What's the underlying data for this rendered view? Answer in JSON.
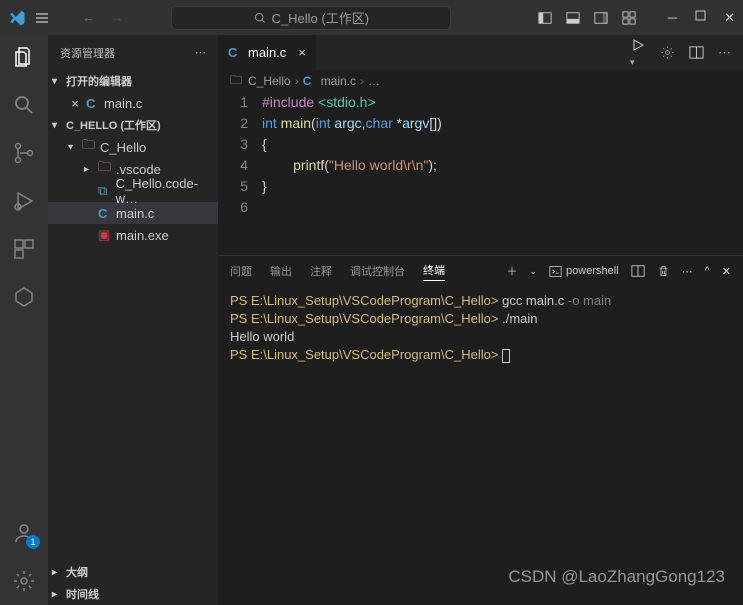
{
  "titlebar": {
    "search_text": "C_Hello (工作区)"
  },
  "sidebar": {
    "title": "资源管理器",
    "open_editors_label": "打开的编辑器",
    "workspace_label": "C_HELLO (工作区)",
    "outline_label": "大纲",
    "timeline_label": "时间线",
    "open_editors": [
      {
        "name": "main.c",
        "icon": "C"
      }
    ],
    "tree": {
      "folder": "C_Hello",
      "children": [
        {
          "name": ".vscode",
          "type": "folder"
        },
        {
          "name": "C_Hello.code-w…",
          "type": "code"
        },
        {
          "name": "main.c",
          "type": "c",
          "active": true
        },
        {
          "name": "main.exe",
          "type": "exe"
        }
      ]
    }
  },
  "accounts_badge": "1",
  "editor": {
    "tab_label": "main.c",
    "breadcrumb": [
      "C_Hello",
      "main.c",
      "…"
    ],
    "lines": [
      "1",
      "2",
      "3",
      "4",
      "5",
      "6"
    ],
    "code": {
      "l1_a": "#include",
      "l1_b": "<stdio.h>",
      "l2_a": "int",
      "l2_b": "main",
      "l2_c": "int",
      "l2_d": "argc",
      "l2_e": "char",
      "l2_f": "argv",
      "l4_a": "printf",
      "l4_b": "\"Hello world\\r\\n\""
    }
  },
  "panel": {
    "tabs": [
      "问题",
      "输出",
      "注释",
      "调试控制台",
      "终端"
    ],
    "active_tab": 4,
    "shell_label": "powershell",
    "terminal": {
      "prompt": "PS E:\\Linux_Setup\\VSCodeProgram\\C_Hello>",
      "cmd1_a": "gcc main.c",
      "cmd1_b": "-o",
      "cmd1_c": "main",
      "cmd2": "./main",
      "out1": "Hello world"
    }
  },
  "watermark": "CSDN @LaoZhangGong123"
}
